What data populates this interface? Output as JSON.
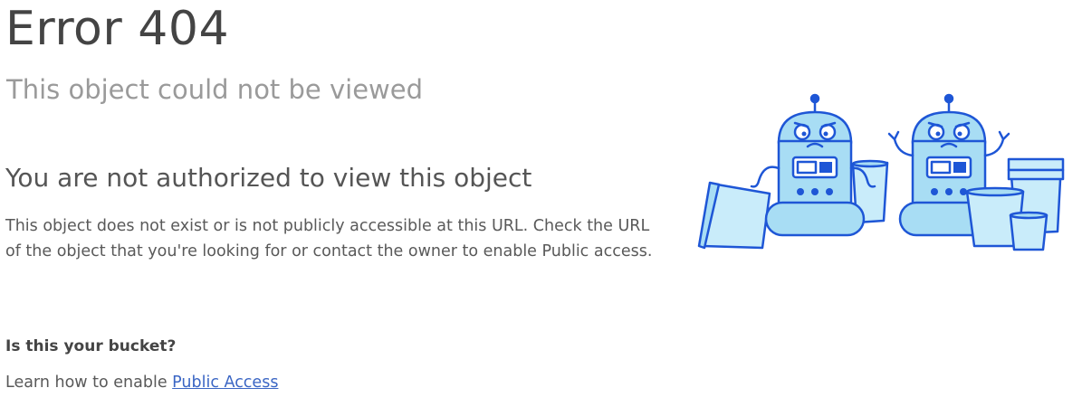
{
  "error": {
    "title": "Error 404",
    "subtitle": "This object could not be viewed"
  },
  "message": {
    "heading": "You are not authorized to view this object",
    "description": "This object does not exist or is not publicly accessible at this URL. Check the URL of the object that you're looking for or contact the owner to enable Public access."
  },
  "help": {
    "question": "Is this your bucket?",
    "learn_prefix": "Learn how to enable ",
    "link_label": "Public Access"
  },
  "illustration": {
    "icon": "sad-robots-with-buckets-illustration",
    "stroke_color": "#1e56d6",
    "fill_color": "#a8ddf4",
    "light_fill_color": "#c9ecfa"
  }
}
